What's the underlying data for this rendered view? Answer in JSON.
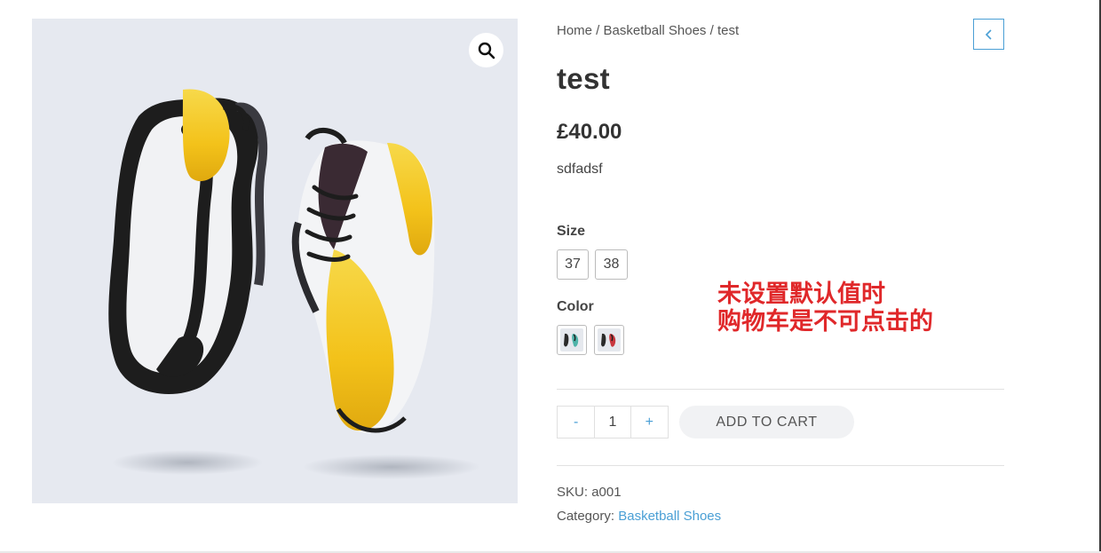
{
  "gallery": {
    "zoom_icon": "magnifier-icon"
  },
  "breadcrumb": {
    "home": "Home",
    "sep1": " / ",
    "category": "Basketball Shoes",
    "sep2": " / ",
    "current": "test"
  },
  "nav": {
    "back_icon": "chevron-left-icon"
  },
  "product": {
    "title": "test",
    "price": "£40.00",
    "short_description": "sdfadsf"
  },
  "attributes": {
    "size_label": "Size",
    "sizes": [
      "37",
      "38"
    ],
    "color_label": "Color"
  },
  "cart": {
    "minus_label": "-",
    "quantity": "1",
    "plus_label": "+",
    "add_to_cart_label": "ADD TO CART",
    "add_to_cart_enabled": false
  },
  "meta": {
    "sku_label": "SKU:",
    "sku_value": "a001",
    "category_label": "Category:",
    "category_value": "Basketball Shoes"
  },
  "annotation": {
    "line1": "未设置默认值时",
    "line2": "购物车是不可点击的"
  },
  "colors": {
    "accent": "#4a9fd5",
    "annotation": "#e0282a",
    "gallery_bg": "#e6e9f0",
    "shoe_yellow": "#f3c21a"
  }
}
